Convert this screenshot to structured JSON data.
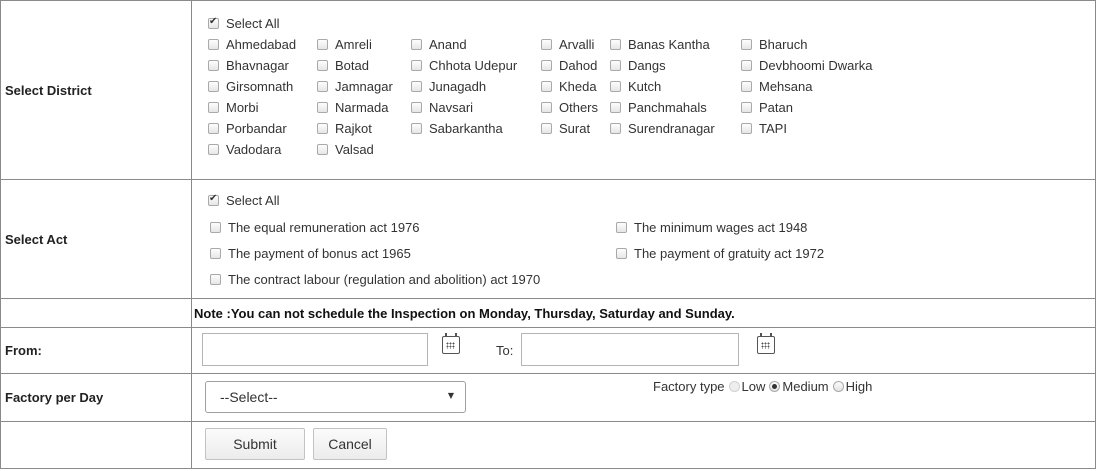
{
  "district": {
    "label": "Select District",
    "select_all": "Select All",
    "items": [
      "Ahmedabad",
      "Amreli",
      "Anand",
      "Arvalli",
      "Banas Kantha",
      "Bharuch",
      "Bhavnagar",
      "Botad",
      "Chhota Udepur",
      "Dahod",
      "Dangs",
      "Devbhoomi Dwarka",
      "Girsomnath",
      "Jamnagar",
      "Junagadh",
      "Kheda",
      "Kutch",
      "Mehsana",
      "Morbi",
      "Narmada",
      "Navsari",
      "Others",
      "Panchmahals",
      "Patan",
      "Porbandar",
      "Rajkot",
      "Sabarkantha",
      "Surat",
      "Surendranagar",
      "TAPI",
      "Vadodara",
      "Valsad"
    ]
  },
  "act": {
    "label": "Select Act",
    "select_all": "Select All",
    "items": [
      "The equal remuneration act 1976",
      "The minimum wages act 1948",
      "The payment of bonus act 1965",
      "The payment of gratuity act 1972",
      "The contract labour (regulation and abolition) act 1970"
    ]
  },
  "note": "Note :You can not schedule the Inspection on Monday, Thursday, Saturday and Sunday.",
  "dates": {
    "from_label": "From:",
    "to_label": "To:",
    "from_value": "",
    "to_value": ""
  },
  "factory": {
    "label": "Factory per Day",
    "select_value": "--Select--",
    "type_label": "Factory type",
    "types": [
      "Low",
      "Medium",
      "High"
    ],
    "selected_type": "Medium"
  },
  "buttons": {
    "submit": "Submit",
    "cancel": "Cancel"
  },
  "icons": {
    "calendar": "calendar-icon",
    "dropdown": "chevron-down-icon"
  }
}
